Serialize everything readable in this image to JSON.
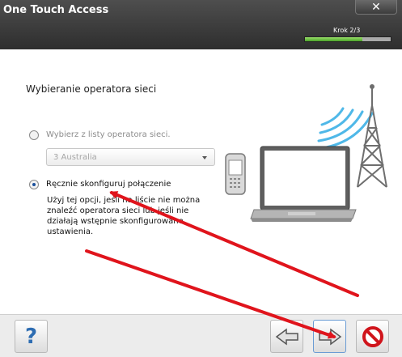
{
  "app": {
    "title": "One Touch Access",
    "close_symbol": "✕"
  },
  "header": {
    "step_label": "Krok 2/3",
    "progress": 0.667
  },
  "main": {
    "section_title": "Wybieranie operatora sieci",
    "options": [
      {
        "label": "Wybierz z listy operatora sieci.",
        "checked": false
      },
      {
        "label": "Ręcznie skonfiguruj połączenie",
        "checked": true
      }
    ],
    "operator_select": {
      "value": "3 Australia"
    },
    "description": [
      "Użyj tej opcji, jeśli na liście nie można",
      "znaleźć operatora sieci lub jeśli nie",
      "działają wstępnie skonfigurowane",
      "ustawienia."
    ]
  },
  "footer": {
    "help_label": "?",
    "icons": [
      "help-icon",
      "back-arrow-icon",
      "next-arrow-icon",
      "cancel-icon"
    ]
  },
  "colors": {
    "titlebar": "#3a3a3a",
    "progress_fill": "#6cc644",
    "radio_selected": "#1a4f9c",
    "annotation_arrow": "#e0141c",
    "cancel": "#d0141b"
  }
}
